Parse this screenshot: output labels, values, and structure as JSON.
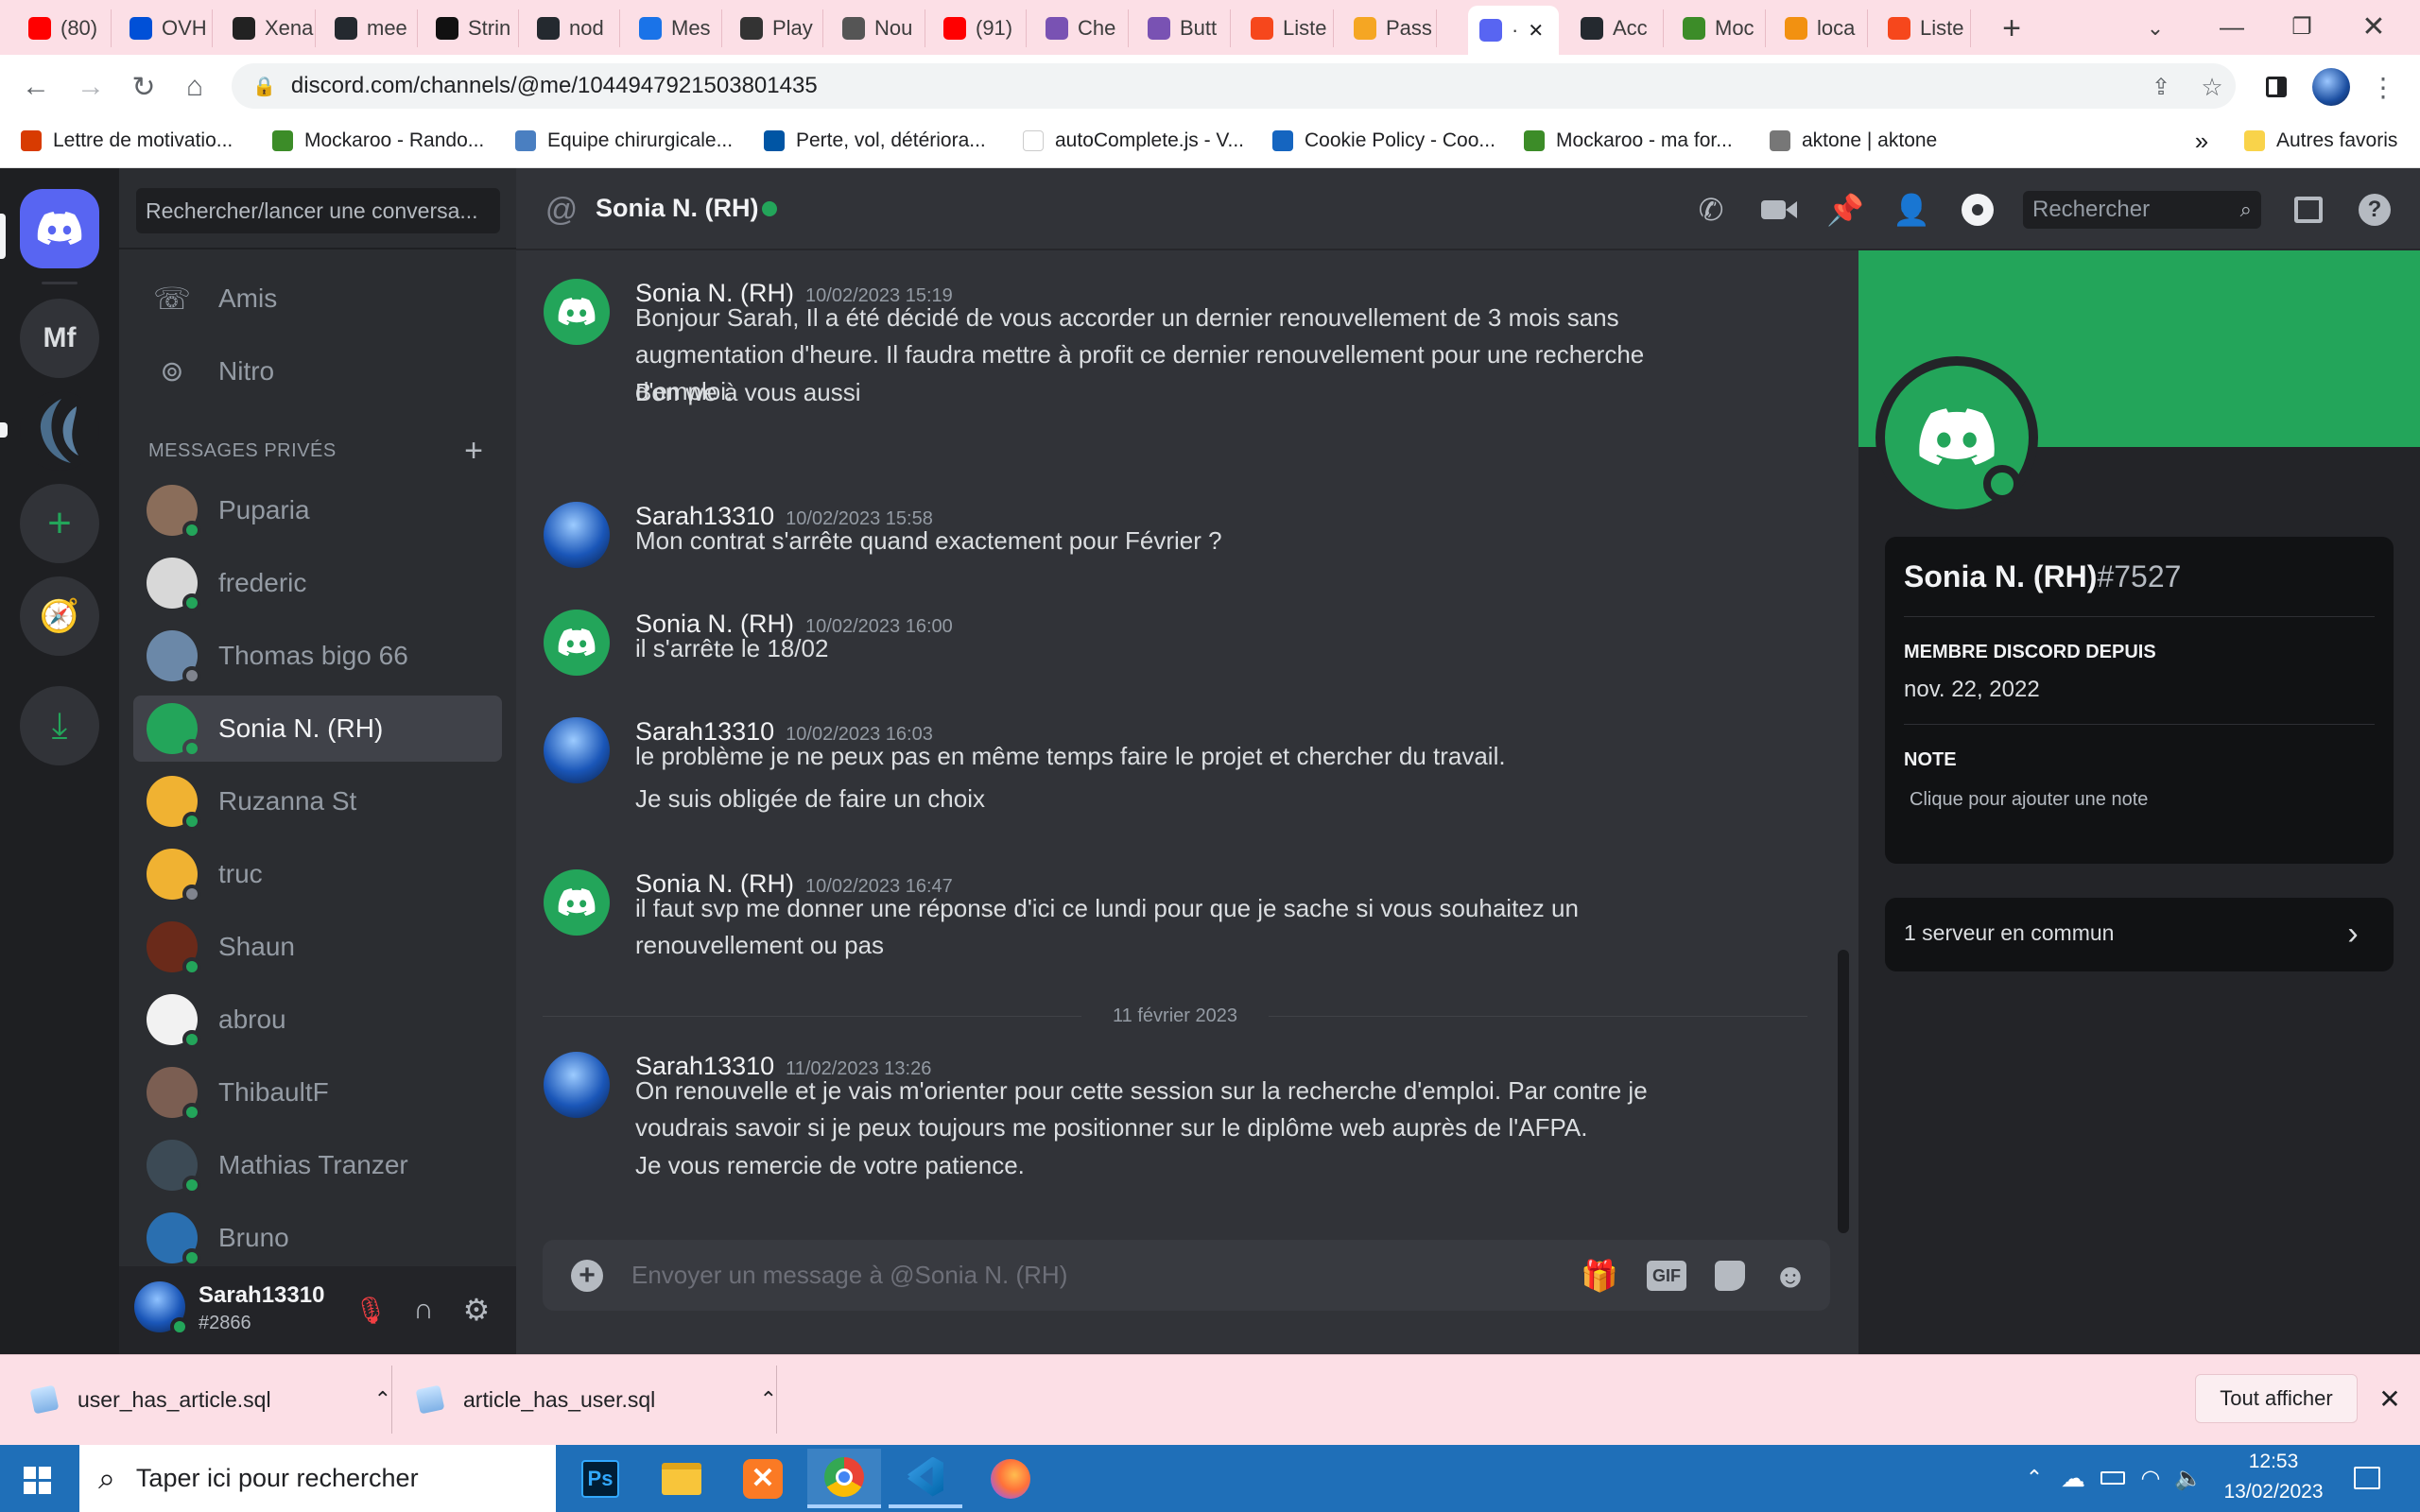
{
  "browser": {
    "tabs": [
      {
        "label": "(80)",
        "color": "#ff0000"
      },
      {
        "label": "OVH",
        "color": "#0050d7"
      },
      {
        "label": "Xena",
        "color": "#222222"
      },
      {
        "label": "mee",
        "color": "#24292f"
      },
      {
        "label": "Strin",
        "color": "#111111"
      },
      {
        "label": "nod",
        "color": "#24292f"
      },
      {
        "label": "Mes",
        "color": "#1a73e8"
      },
      {
        "label": "Play",
        "color": "#333333"
      },
      {
        "label": "Nou",
        "color": "#555555"
      },
      {
        "label": "(91)",
        "color": "#ff0000"
      },
      {
        "label": "Che",
        "color": "#7952b3"
      },
      {
        "label": "Butt",
        "color": "#7952b3"
      },
      {
        "label": "Liste",
        "color": "#f6471c"
      },
      {
        "label": "Pass",
        "color": "#f5a623"
      },
      {
        "label": "·",
        "color": "#5865f2"
      },
      {
        "label": "Acc",
        "color": "#24292f"
      },
      {
        "label": "Moc",
        "color": "#3c8c28"
      },
      {
        "label": "loca",
        "color": "#f29111"
      },
      {
        "label": "Liste",
        "color": "#f6471c"
      }
    ],
    "url": "discord.com/channels/@me/1044947921503801435",
    "bookmarks": [
      {
        "label": "Lettre de motivatio...",
        "color": "#d83b01"
      },
      {
        "label": "Mockaroo - Rando...",
        "color": "#3c8c28"
      },
      {
        "label": "Equipe chirurgicale...",
        "color": "#4a7fc1"
      },
      {
        "label": "Perte, vol, détériora...",
        "color": "#0055a4"
      },
      {
        "label": "autoComplete.js - V...",
        "color": "#ffffff"
      },
      {
        "label": "Cookie Policy - Coo...",
        "color": "#1565c0"
      },
      {
        "label": "Mockaroo - ma for...",
        "color": "#3c8c28"
      },
      {
        "label": "aktone | aktone",
        "color": "#777777"
      }
    ],
    "other_bookmarks": "Autres favoris"
  },
  "discord": {
    "search_placeholder": "Rechercher/lancer une conversa...",
    "server_mf": "Mf",
    "nav": {
      "friends": "Amis",
      "nitro": "Nitro"
    },
    "dm_header": "MESSAGES PRIVÉS",
    "dms": [
      {
        "name": "Puparia",
        "status": "online",
        "avatar_color": "#8a6d5a"
      },
      {
        "name": "frederic",
        "status": "online",
        "avatar_color": "#d8d8d8"
      },
      {
        "name": "Thomas bigo 66",
        "status": "offline",
        "avatar_color": "#6b88a8"
      },
      {
        "name": "Sonia N. (RH)",
        "status": "online",
        "avatar_color": "#23a55a"
      },
      {
        "name": "Ruzanna St",
        "status": "online",
        "avatar_color": "#f0b232"
      },
      {
        "name": "truc",
        "status": "offline",
        "avatar_color": "#f0b232"
      },
      {
        "name": "Shaun",
        "status": "online",
        "avatar_color": "#6a2a1a"
      },
      {
        "name": "abrou",
        "status": "online",
        "avatar_color": "#f2f2f2"
      },
      {
        "name": "ThibaultF",
        "status": "online",
        "avatar_color": "#7b5e52"
      },
      {
        "name": "Mathias Tranzer",
        "status": "online",
        "avatar_color": "#3c4a55"
      },
      {
        "name": "Bruno",
        "status": "online",
        "avatar_color": "#2a6fb0"
      }
    ],
    "user": {
      "name": "Sarah13310",
      "tag": "#2866"
    },
    "channel": {
      "name": "Sonia N. (RH)",
      "search_placeholder": "Rechercher"
    },
    "messages": [
      {
        "author": "Sonia N. (RH)",
        "time": "10/02/2023 15:19",
        "lines": [
          "Bonjour Sarah, Il a été décidé de vous accorder un dernier renouvellement de 3 mois sans augmentation d'heure. Il faudra mettre à profit ce dernier renouvellement pour une recherche d'emploi.",
          "Bon we à vous aussi"
        ]
      },
      {
        "author": "Sarah13310",
        "time": "10/02/2023 15:58",
        "lines": [
          "Mon contrat s'arrête quand exactement pour Février ?"
        ]
      },
      {
        "author": "Sonia N. (RH)",
        "time": "10/02/2023 16:00",
        "lines": [
          "il s'arrête le 18/02"
        ]
      },
      {
        "author": "Sarah13310",
        "time": "10/02/2023 16:03",
        "lines": [
          "le problème je ne peux pas en même temps faire le projet et chercher du travail.",
          "Je suis obligée de faire un choix"
        ]
      },
      {
        "author": "Sonia N. (RH)",
        "time": "10/02/2023 16:47",
        "lines": [
          "il faut svp me donner une réponse d'ici ce lundi pour que je sache si vous souhaitez un renouvellement ou pas"
        ]
      },
      {
        "author": "Sarah13310",
        "time": "11/02/2023 13:26",
        "lines": [
          "On renouvelle et je vais m'orienter pour cette session sur la recherche d'emploi. Par contre je voudrais savoir si je peux toujours me positionner sur le diplôme web auprès de l'AFPA.",
          "Je vous remercie de votre patience."
        ]
      }
    ],
    "date_divider": "11 février 2023",
    "input_placeholder": "Envoyer un message à @Sonia N. (RH)",
    "gif_label": "GIF",
    "profile": {
      "name": "Sonia N. (RH)",
      "discriminator": "#7527",
      "member_since_label": "MEMBRE DISCORD DEPUIS",
      "member_since": "nov. 22, 2022",
      "note_label": "NOTE",
      "note_placeholder": "Clique pour ajouter une note",
      "mutual_servers": "1 serveur en commun"
    }
  },
  "downloads": {
    "items": [
      "user_has_article.sql",
      "article_has_user.sql"
    ],
    "show_all": "Tout afficher"
  },
  "taskbar": {
    "search_placeholder": "Taper ici pour rechercher",
    "ps_label": "Ps",
    "time": "12:53",
    "date": "13/02/2023"
  }
}
